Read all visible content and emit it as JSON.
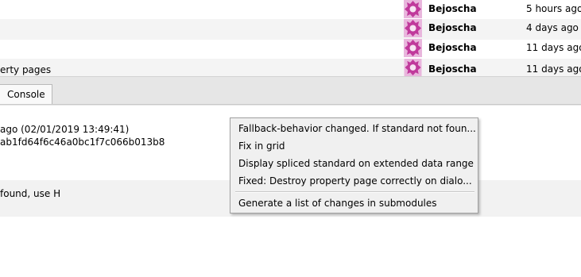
{
  "commits": [
    {
      "subject": "",
      "author": "Bejoscha",
      "date": "5 hours ago"
    },
    {
      "subject": "",
      "author": "Bejoscha",
      "date": "4 days ago"
    },
    {
      "subject": "",
      "author": "Bejoscha",
      "date": "11 days ago"
    },
    {
      "subject": "erty pages",
      "author": "Bejoscha",
      "date": "11 days ago"
    }
  ],
  "tabs": {
    "console": "Console"
  },
  "details": {
    "date_line": "ago (02/01/2019 13:49:41)",
    "hash_line": "ab1fd64f6c46a0bc1f7c066b013b8",
    "message_line": "found, use H"
  },
  "context_menu": {
    "items": [
      "Fallback-behavior changed. If standard not foun...",
      "Fix in grid",
      "Display spliced standard on extended data range",
      "Fixed: Destroy property page correctly on dialo...",
      "Generate a list of changes in submodules"
    ]
  },
  "colors": {
    "avatar_accent": "#c0399b",
    "tabbar_bg": "#e6e6e6"
  }
}
